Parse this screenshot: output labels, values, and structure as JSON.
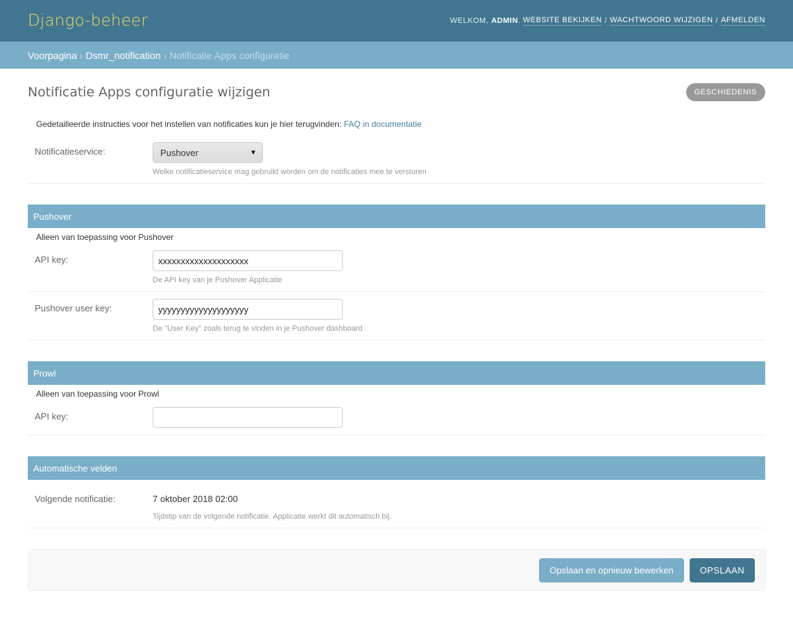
{
  "header": {
    "branding": "Django-beheer",
    "welcome": "Welkom,",
    "username": "admin",
    "links": {
      "view_site": "Website bekijken",
      "change_password": "Wachtwoord wijzigen",
      "logout": "Afmelden"
    },
    "separator": "/"
  },
  "breadcrumbs": {
    "items": [
      "Voorpagina",
      "Dsmr_notification",
      "Notificatie Apps configuratie"
    ],
    "arrow": "›"
  },
  "page": {
    "title": "Notificatie Apps configuratie wijzigen",
    "history_label": "Geschiedenis"
  },
  "intro": {
    "text": "Gedetailleerde instructies voor het instellen van notificaties kun je hier terugvinden: ",
    "link": "FAQ in documentatie"
  },
  "general": {
    "notification_service": {
      "label": "Notificatieservice:",
      "value": "Pushover",
      "help": "Welke notificatieservice mag gebruikt worden om de notificaties mee te versturen"
    }
  },
  "pushover": {
    "header": "Pushover",
    "description": "Alleen van toepassing voor Pushover",
    "api_key": {
      "label": "API key:",
      "value": "xxxxxxxxxxxxxxxxxxxx",
      "help": "De API key van je Pushover Applicatie"
    },
    "user_key": {
      "label": "Pushover user key:",
      "value": "yyyyyyyyyyyyyyyyyyyy",
      "help": "De \"User Key\" zoals terug te vinden in je Pushover dashboard"
    }
  },
  "prowl": {
    "header": "Prowl",
    "description": "Alleen van toepassing voor Prowl",
    "api_key": {
      "label": "API key:",
      "value": ""
    }
  },
  "automatic": {
    "header": "Automatische velden",
    "next_notification": {
      "label": "Volgende notificatie:",
      "value": "7 oktober 2018 02:00",
      "help": "Tijdstip van de volgende notificatie. Applicatie werkt dit automatisch bij."
    }
  },
  "submit": {
    "save_continue": "Opslaan en opnieuw bewerken",
    "save": "Opslaan"
  },
  "icons": {
    "select_caret": "▼"
  }
}
